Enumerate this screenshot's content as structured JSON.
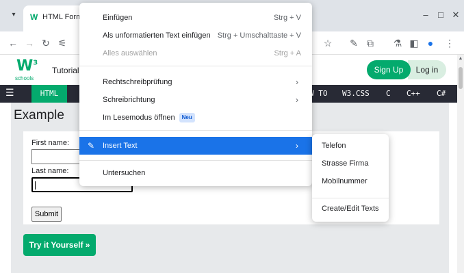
{
  "browser": {
    "tab_title": "HTML Forms",
    "tab_favicon": "W",
    "icons": {
      "tab_dropdown": "chevron-down-icon",
      "back": "arrow-left-icon",
      "forward": "arrow-right-icon",
      "reload": "reload-icon",
      "site_info": "tune-icon",
      "bookmark": "star-icon",
      "pen": "pen-icon",
      "extensions": "puzzle-icon",
      "lab": "flask-icon",
      "sidepanel": "sidepanel-icon",
      "profile": "profile-icon",
      "menu": "kebab-menu-icon"
    }
  },
  "site": {
    "logo": "W",
    "logo_sup": "3",
    "logo_sub": "schools",
    "tutorials_label": "Tutorial",
    "signup_label": "Sign Up",
    "login_label": "Log in",
    "nav": {
      "html": "HTML",
      "howto": "W TO",
      "w3css": "W3.CSS",
      "c": "C",
      "cpp": "C++",
      "csharp": "C#"
    }
  },
  "example": {
    "title": "Example",
    "first_name_label": "First name:",
    "last_name_label": "Last name:",
    "submit_label": "Submit",
    "tryit_label": "Try it Yourself »"
  },
  "context_menu": {
    "paste": "Einfügen",
    "paste_shortcut": "Strg + V",
    "paste_plain": "Als unformatierten Text einfügen",
    "paste_plain_shortcut": "Strg + Umschalttaste + V",
    "select_all": "Alles auswählen",
    "select_all_shortcut": "Strg + A",
    "spellcheck": "Rechtschreibprüfung",
    "writing_direction": "Schreibrichtung",
    "reading_mode": "Im Lesemodus öffnen",
    "reading_mode_badge": "Neu",
    "insert_text": "Insert Text",
    "inspect": "Untersuchen"
  },
  "submenu": {
    "items": [
      "Telefon",
      "Strasse Firma",
      "Mobilnummer"
    ],
    "create_edit": "Create/Edit Texts"
  },
  "colors": {
    "accent": "#04aa6d",
    "nav_bg": "#282a35",
    "menu_highlight": "#1a73e8"
  }
}
